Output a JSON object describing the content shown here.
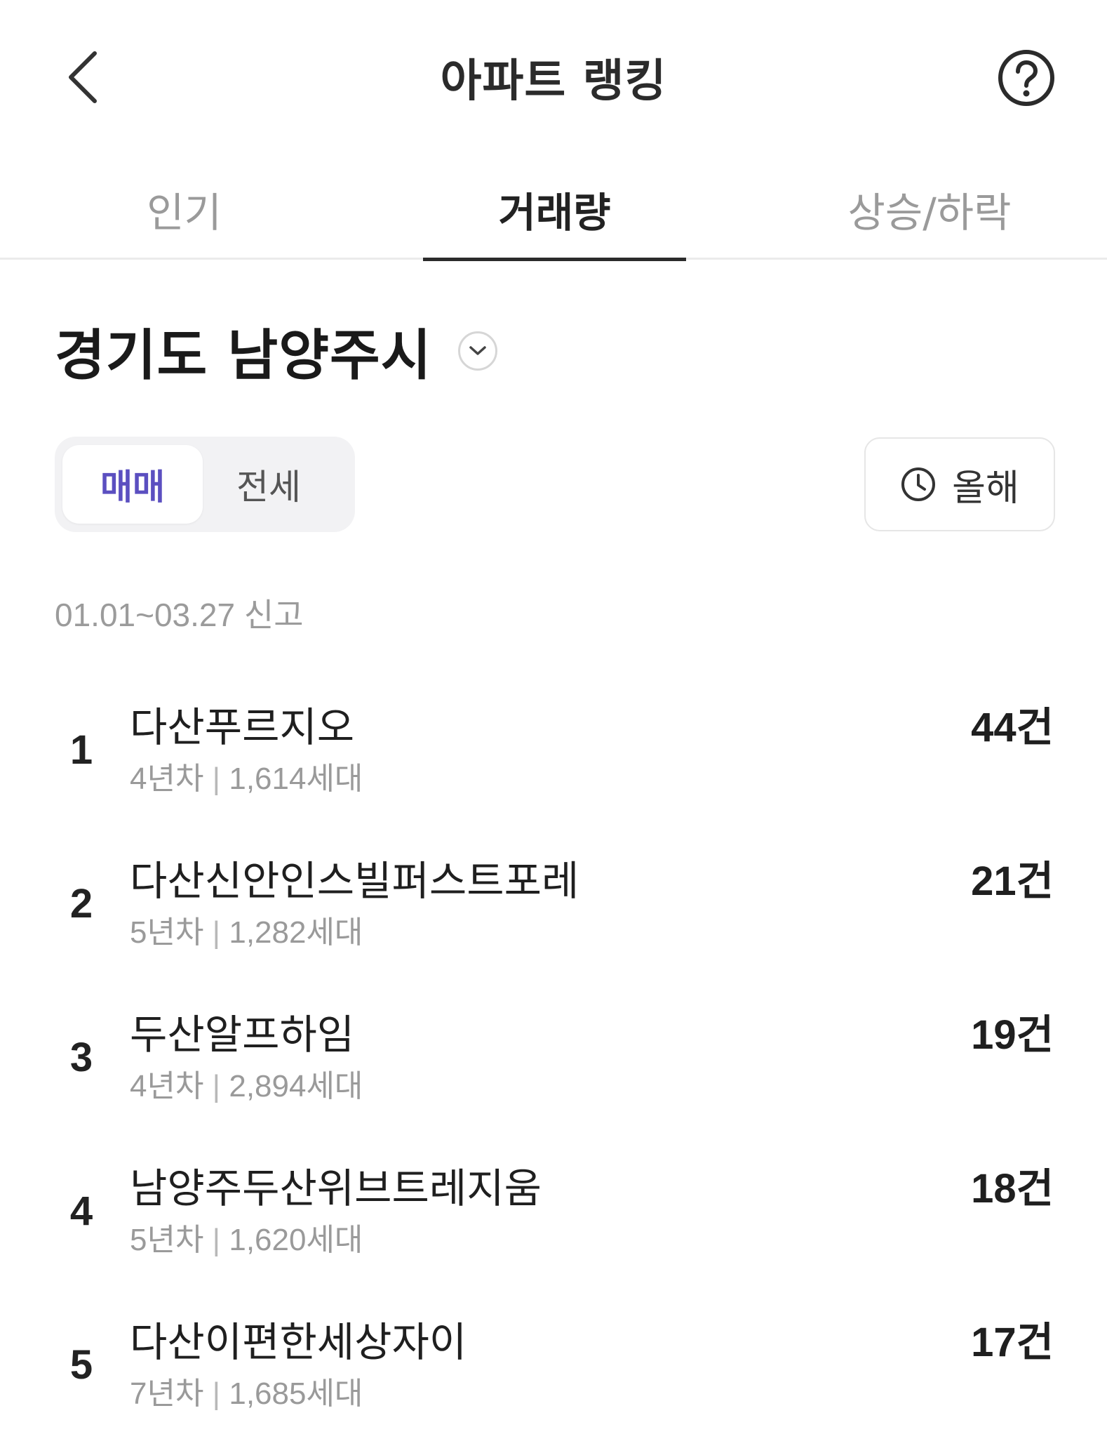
{
  "header": {
    "title": "아파트 랭킹"
  },
  "tabs": [
    {
      "label": "인기",
      "active": false
    },
    {
      "label": "거래량",
      "active": true
    },
    {
      "label": "상승/하락",
      "active": false
    }
  ],
  "region": {
    "name": "경기도 남양주시"
  },
  "trade_type": {
    "options": [
      "매매",
      "전세"
    ],
    "selected": "매매"
  },
  "period": {
    "label": "올해"
  },
  "date_range": "01.01~03.27 신고",
  "rankings": [
    {
      "rank": "1",
      "name": "다산푸르지오",
      "age": "4년차",
      "households": "1,614세대",
      "count": "44건"
    },
    {
      "rank": "2",
      "name": "다산신안인스빌퍼스트포레",
      "age": "5년차",
      "households": "1,282세대",
      "count": "21건"
    },
    {
      "rank": "3",
      "name": "두산알프하임",
      "age": "4년차",
      "households": "2,894세대",
      "count": "19건"
    },
    {
      "rank": "4",
      "name": "남양주두산위브트레지움",
      "age": "5년차",
      "households": "1,620세대",
      "count": "18건"
    },
    {
      "rank": "5",
      "name": "다산이편한세상자이",
      "age": "7년차",
      "households": "1,685세대",
      "count": "17건"
    }
  ],
  "colors": {
    "accent": "#5b4fc0",
    "text": "#222222",
    "muted": "#9a9a9a",
    "divider": "#ebebeb"
  },
  "icons": {
    "back": "chevron-left-icon",
    "help": "question-circle-icon",
    "region_dropdown": "chevron-down-icon",
    "period": "clock-icon"
  }
}
